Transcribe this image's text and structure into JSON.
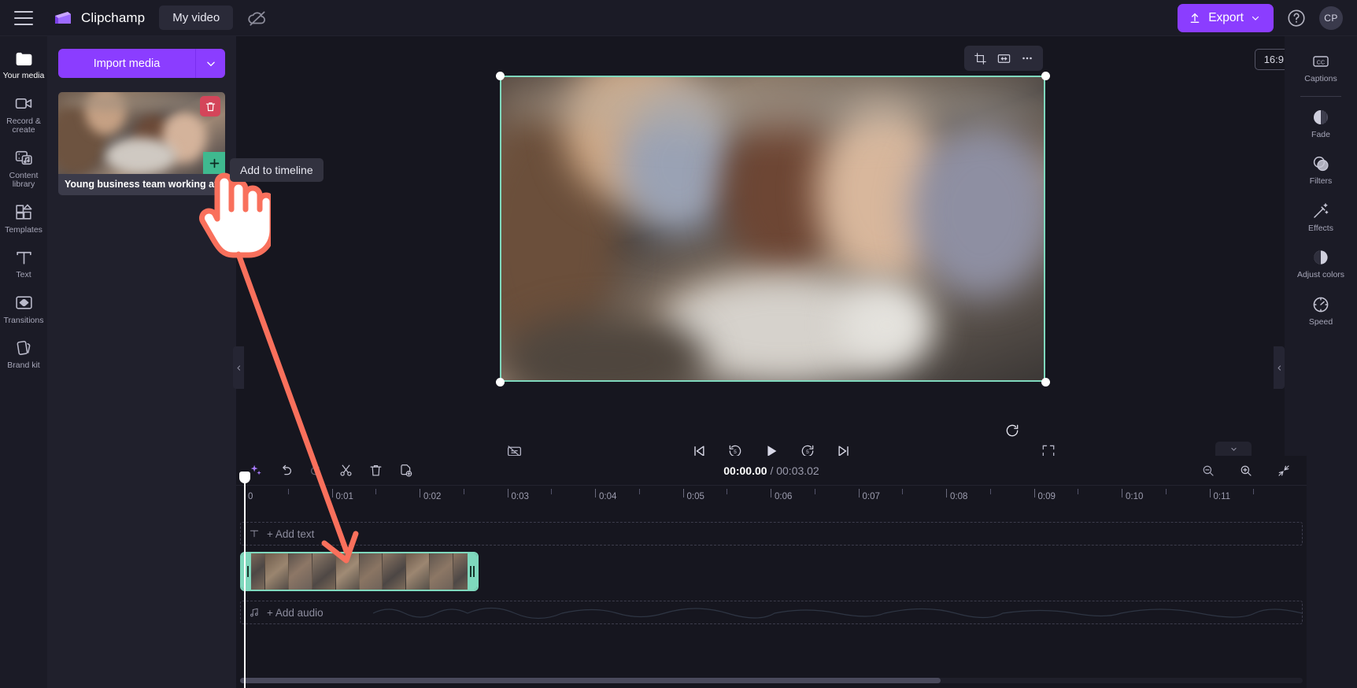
{
  "app": {
    "brand_name": "Clipchamp",
    "project_tab": "My video",
    "cloud_status_icon": "cloud-off-icon",
    "menu_icon": "hamburger-menu-icon"
  },
  "topbar": {
    "export_label": "Export",
    "export_icon": "upload-icon",
    "export_caret_icon": "chevron-down-icon",
    "help_icon": "question-circle-icon",
    "avatar_initials": "CP",
    "accent_color": "#8b3dff"
  },
  "left_rail": {
    "items": [
      {
        "label": "Your media",
        "icon": "media-folder-icon",
        "active": true
      },
      {
        "label": "Record & create",
        "icon": "video-camera-icon",
        "active": false
      },
      {
        "label": "Content library",
        "icon": "content-library-icon",
        "active": false
      },
      {
        "label": "Templates",
        "icon": "templates-grid-icon",
        "active": false
      },
      {
        "label": "Text",
        "icon": "text-t-icon",
        "active": false
      },
      {
        "label": "Transitions",
        "icon": "transitions-icon",
        "active": false
      },
      {
        "label": "Brand kit",
        "icon": "brand-kit-icon",
        "active": false
      }
    ]
  },
  "media_panel": {
    "import_label": "Import media",
    "import_caret_icon": "chevron-down-icon",
    "asset": {
      "name": "Young business team working at o",
      "delete_icon": "trash-icon",
      "add_icon": "plus-icon",
      "add_color": "#3fb98f",
      "delete_color": "#d4455a"
    },
    "collapse_icon": "chevron-left-icon"
  },
  "tooltip": {
    "text": "Add to timeline"
  },
  "preview": {
    "float_tools": [
      {
        "icon": "crop-icon",
        "name": "crop-tool"
      },
      {
        "icon": "fit-fill-icon",
        "name": "fit-fill-tool"
      },
      {
        "icon": "more-horizontal-icon",
        "name": "more-options-tool"
      }
    ],
    "aspect_ratio": "16:9",
    "selection_color": "#7fd8bd",
    "rotate_icon": "rotate-icon",
    "collapse_icon": "chevron-left-icon",
    "controls": {
      "captions_off_icon": "captions-off-icon",
      "skip_start_icon": "skip-to-start-icon",
      "back5_icon": "rewind-5-icon",
      "play_icon": "play-icon",
      "fwd5_icon": "forward-5-icon",
      "skip_end_icon": "skip-to-end-icon",
      "fullscreen_icon": "fullscreen-icon"
    }
  },
  "right_rail": {
    "items": [
      {
        "label": "Captions",
        "icon": "cc-icon"
      },
      {
        "label": "Fade",
        "icon": "fade-icon"
      },
      {
        "label": "Filters",
        "icon": "filters-icon"
      },
      {
        "label": "Effects",
        "icon": "effects-wand-icon"
      },
      {
        "label": "Adjust colors",
        "icon": "adjust-colors-icon"
      },
      {
        "label": "Speed",
        "icon": "speed-gauge-icon"
      }
    ]
  },
  "timeline": {
    "collapse_icon": "chevron-down-icon",
    "toolbar": [
      {
        "icon": "magic-sparkle-icon",
        "name": "auto-compose-button"
      },
      {
        "icon": "undo-icon",
        "name": "undo-button"
      },
      {
        "icon": "redo-icon",
        "name": "redo-button"
      },
      {
        "icon": "scissors-icon",
        "name": "split-button"
      },
      {
        "icon": "trash-icon",
        "name": "delete-button"
      },
      {
        "icon": "duplicate-icon",
        "name": "duplicate-button"
      }
    ],
    "current_time": "00:00.00",
    "time_separator": " / ",
    "total_time": "00:03.02",
    "zoom_controls": [
      {
        "icon": "zoom-out-icon",
        "name": "zoom-out-button"
      },
      {
        "icon": "zoom-in-icon",
        "name": "zoom-in-button"
      },
      {
        "icon": "fit-timeline-icon",
        "name": "fit-timeline-button"
      }
    ],
    "ruler_labels": [
      "0",
      "0:01",
      "0:02",
      "0:03",
      "0:04",
      "0:05",
      "0:06",
      "0:07",
      "0:08",
      "0:09",
      "0:10",
      "0:11"
    ],
    "text_track": {
      "label": "+ Add text",
      "icon": "text-t-icon"
    },
    "audio_track": {
      "label": "+ Add audio",
      "icon": "music-note-icon"
    },
    "clip": {
      "selected": true,
      "border_color": "#7fd8bd"
    }
  },
  "annotation": {
    "arrow_color": "#f9705c",
    "cursor_icon": "pointing-hand-cursor"
  }
}
